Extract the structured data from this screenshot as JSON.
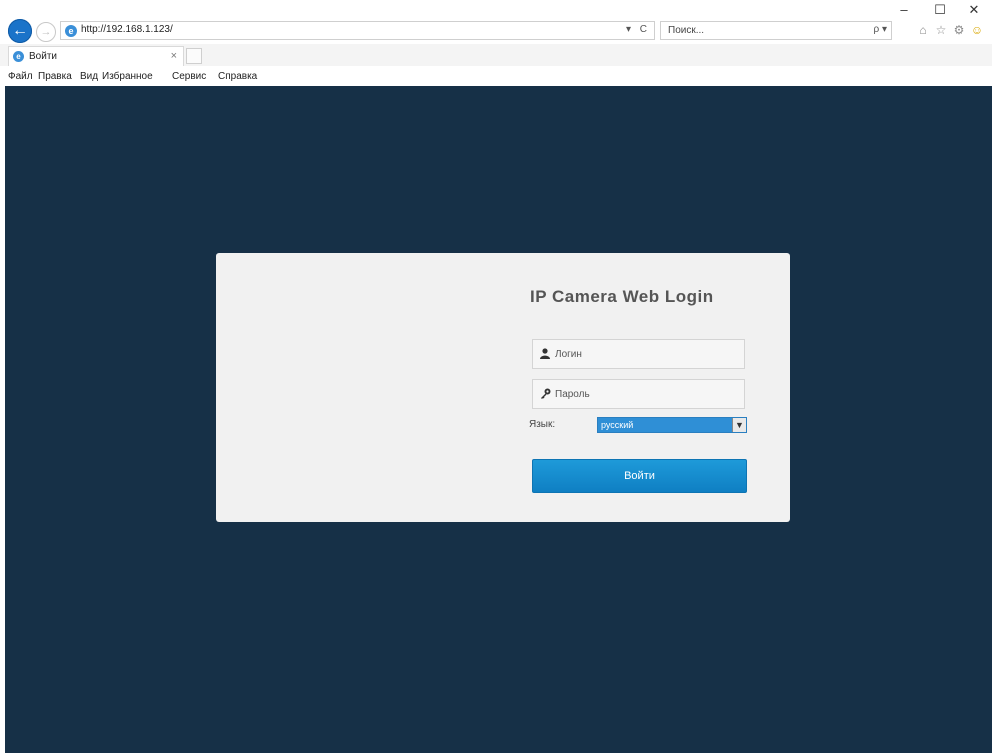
{
  "window": {
    "minimize": "–",
    "maximize": "☐",
    "close": "✕"
  },
  "toolbar": {
    "back": "←",
    "forward": "→",
    "url": "http://192.168.1.123/",
    "addr_tools": "▾ C",
    "search_placeholder": "Поиск...",
    "search_btn": "ρ ▾",
    "icons": [
      "home-icon",
      "star-icon",
      "settings-icon",
      "smiley-icon"
    ],
    "home": "⌂",
    "star": "☆",
    "settings": "⚙",
    "smiley": "☺"
  },
  "tabs": [
    {
      "title": "Войти",
      "close": "×"
    }
  ],
  "menu": [
    "Файл",
    "Правка",
    "Вид",
    "Избранное",
    "Сервис",
    "Справка"
  ],
  "login": {
    "title": "IP Camera Web Login",
    "username_placeholder": "Логин",
    "password_placeholder": "Пароль",
    "language_label": "Язык:",
    "language_value": "русский",
    "submit": "Войти",
    "user_icon": "user-icon",
    "key_icon": "key-icon"
  },
  "colors": {
    "page_background": "#163047",
    "panel_background": "#f1f1f1",
    "button_blue": "#1a8bd0"
  }
}
